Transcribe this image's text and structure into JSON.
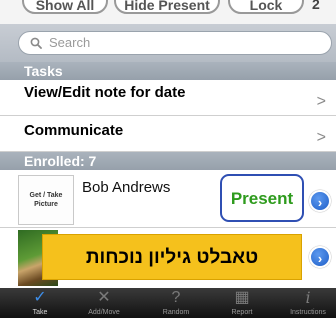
{
  "top_buttons": {
    "show_all": "Show All",
    "hide_present": "Hide Present",
    "lock": "Lock",
    "badge": "2"
  },
  "search": {
    "placeholder": "Search"
  },
  "tasks": {
    "header": "Tasks",
    "items": [
      {
        "label": "View/Edit note for date"
      },
      {
        "label": "Communicate"
      }
    ]
  },
  "enrolled": {
    "header": "Enrolled: 7",
    "students": [
      {
        "name": "Bob Andrews",
        "photo_placeholder": "Get / Take Picture",
        "status": "Present"
      }
    ]
  },
  "banner": {
    "text": "טאבלט גיליון נוכחות"
  },
  "tabs": [
    {
      "label": "Take",
      "icon": "checkmark-icon",
      "active": true
    },
    {
      "label": "Add/Move",
      "icon": "pin-icon",
      "active": false
    },
    {
      "label": "Random",
      "icon": "question-icon",
      "active": false
    },
    {
      "label": "Report",
      "icon": "grid-icon",
      "active": false
    },
    {
      "label": "Instructions",
      "icon": "info-icon",
      "active": false
    }
  ],
  "colors": {
    "present_green": "#2e9b1d",
    "present_border": "#2f4fb3",
    "banner_yellow": "#f5c11c",
    "section_header": "#96a0ab",
    "tab_active": "#3d8de8"
  }
}
